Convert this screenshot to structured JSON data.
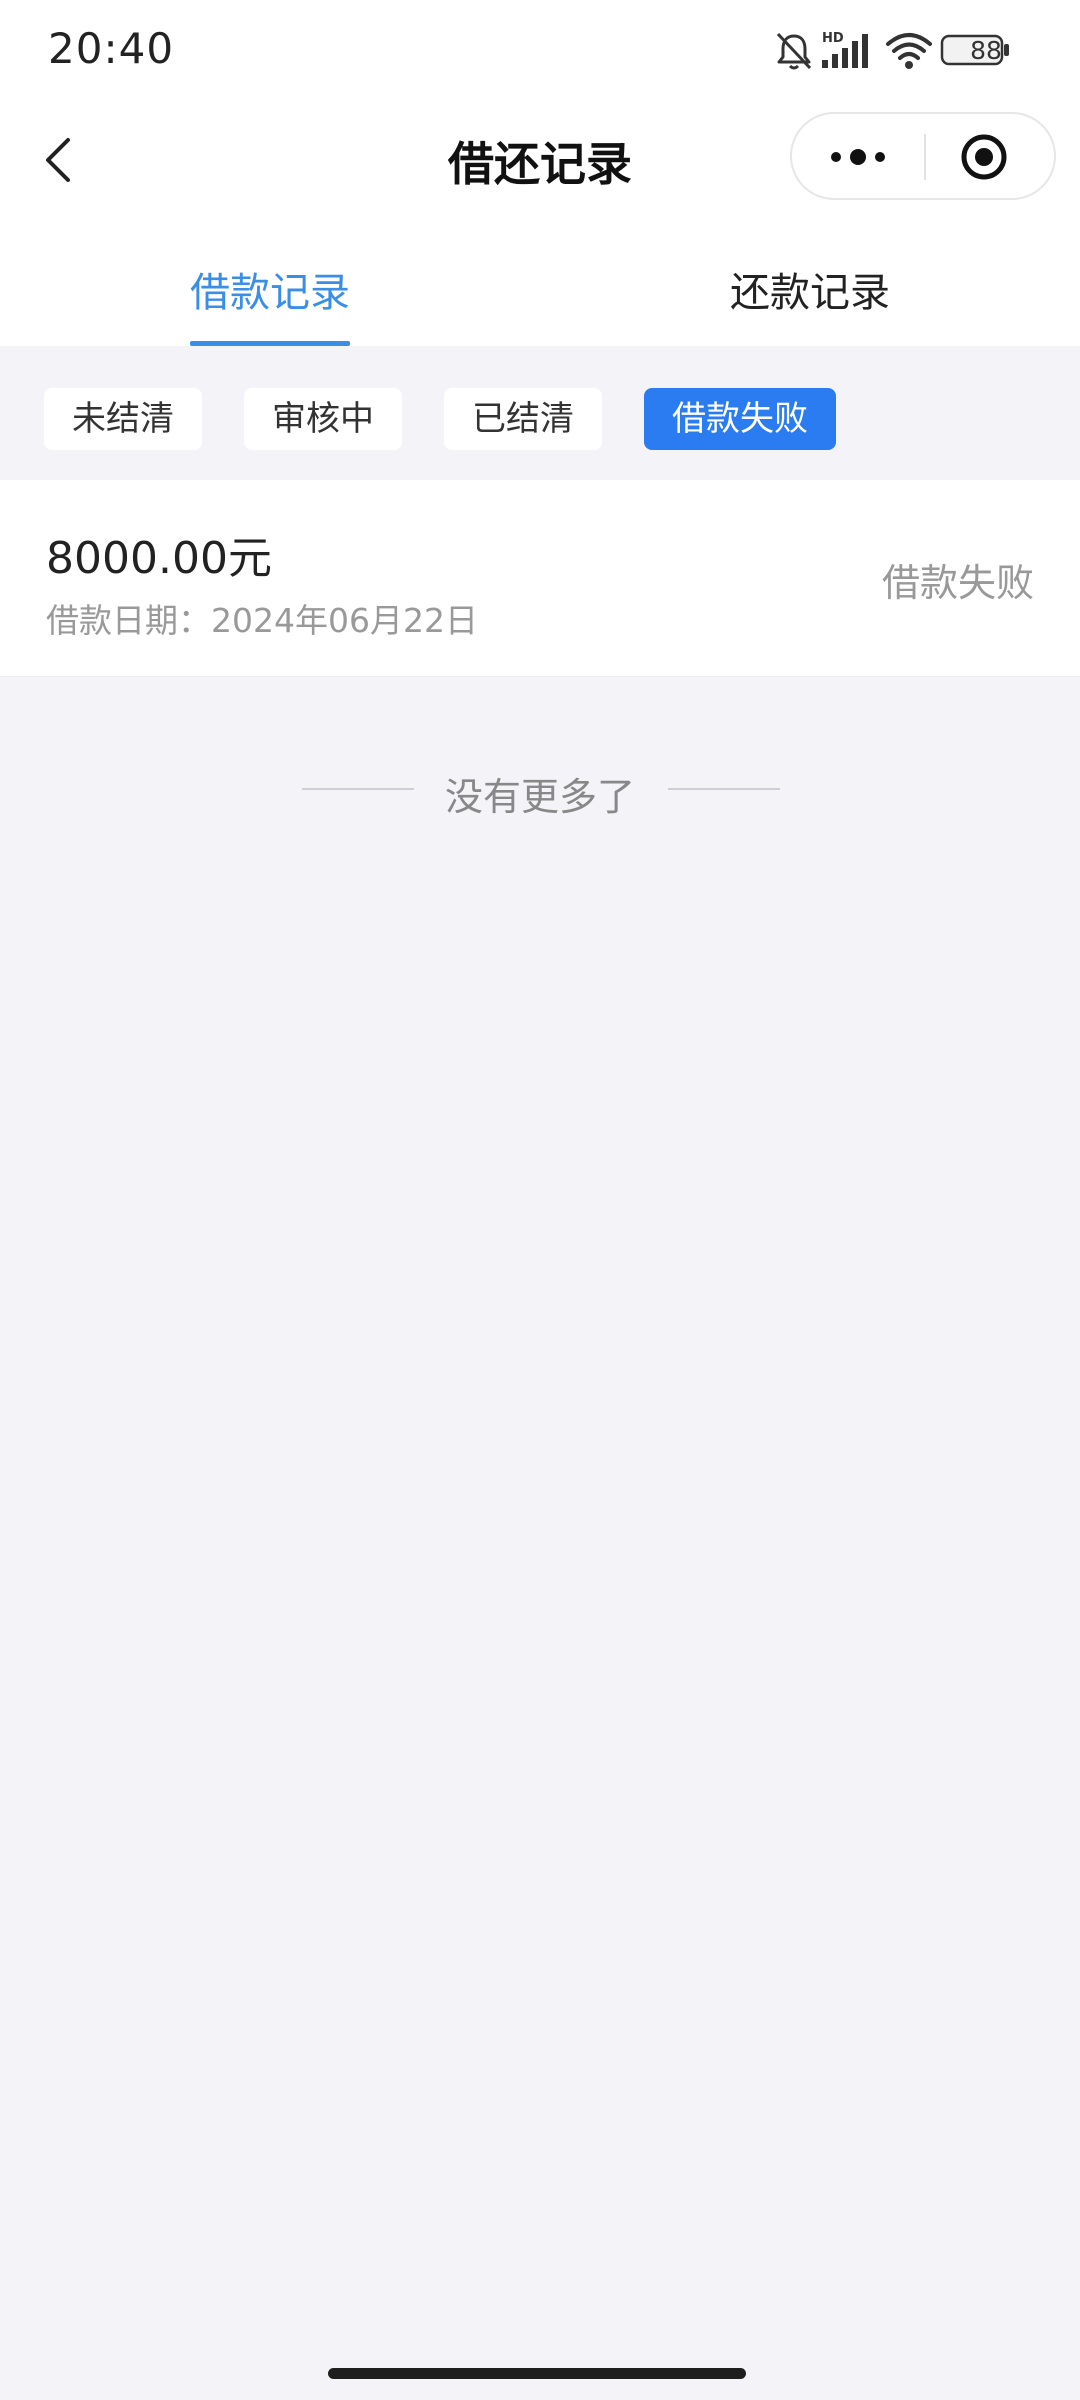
{
  "status_bar": {
    "time": "20:40",
    "network_label": "HD",
    "battery_level": "88",
    "icons": [
      "bell-off-icon",
      "signal-icon",
      "wifi-icon",
      "battery-icon"
    ]
  },
  "nav": {
    "title": "借还记录",
    "back_icon": "chevron-left-icon",
    "menu_icon": "more-dots-icon",
    "close_icon": "target-circle-icon"
  },
  "tabs": [
    {
      "label": "借款记录",
      "active": true
    },
    {
      "label": "还款记录",
      "active": false
    }
  ],
  "filters": [
    {
      "label": "未结清",
      "active": false
    },
    {
      "label": "审核中",
      "active": false
    },
    {
      "label": "已结清",
      "active": false
    },
    {
      "label": "借款失败",
      "active": true
    }
  ],
  "records": [
    {
      "amount": "8000.00元",
      "date_label": "借款日期：",
      "date": "2024年06月22日",
      "status": "借款失败"
    }
  ],
  "list_end_text": "没有更多了",
  "colors": {
    "accent": "#3a8ee6",
    "chip_active": "#2a7cf0",
    "page_background": "#f3f3f8",
    "muted_text": "#999999"
  }
}
